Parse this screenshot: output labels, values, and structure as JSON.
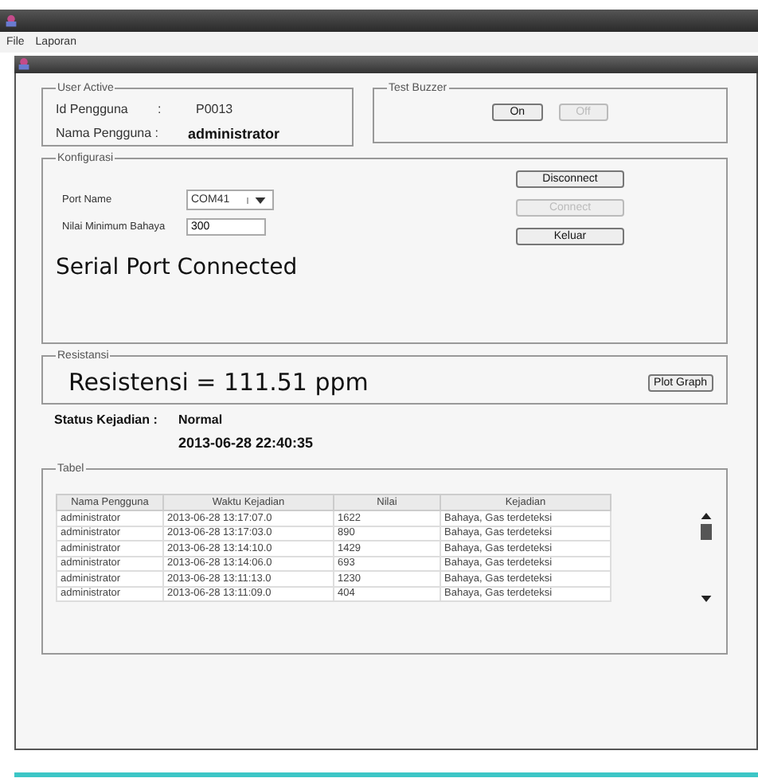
{
  "menu": [
    "File",
    "Laporan"
  ],
  "user_active": {
    "title": "User Active",
    "id_label": "Id Pengguna",
    "id_sep": ":",
    "id_value": "P0013",
    "name_label": "Nama Pengguna :",
    "name_value": "administrator"
  },
  "test_buzzer": {
    "title": "Test Buzzer",
    "buttons": [
      {
        "label": "On",
        "disabled": false
      },
      {
        "label": "Off",
        "disabled": true
      }
    ]
  },
  "konfigurasi": {
    "title": "Konfigurasi",
    "port_label": "Port Name",
    "port_value": "COM41",
    "min_label": "Nilai Minimum Bahaya",
    "min_value": "300",
    "status": "Serial Port Connected",
    "buttons": [
      {
        "label": "Disconnect",
        "disabled": false
      },
      {
        "label": "Connect",
        "disabled": true
      },
      {
        "label": "Keluar",
        "disabled": false
      }
    ]
  },
  "resistansi": {
    "title": "Resistansi",
    "reading": "Resistensi = 111.51 ppm",
    "button": "Plot Graph"
  },
  "status": {
    "label": "Status Kejadian :",
    "value": "Normal",
    "time": "2013-06-28 22:40:35"
  },
  "tabel": {
    "title": "Tabel",
    "columns": [
      "Nama Pengguna",
      "Waktu Kejadian",
      "Nilai",
      "Kejadian"
    ],
    "rows": [
      [
        "administrator",
        "2013-06-28 13:17:07.0",
        "1622",
        "Bahaya, Gas terdeteksi"
      ],
      [
        "administrator",
        "2013-06-28 13:17:03.0",
        "890",
        "Bahaya, Gas terdeteksi"
      ],
      [
        "administrator",
        "2013-06-28 13:14:10.0",
        "1429",
        "Bahaya, Gas terdeteksi"
      ],
      [
        "administrator",
        "2013-06-28 13:14:06.0",
        "693",
        "Bahaya, Gas terdeteksi"
      ],
      [
        "administrator",
        "2013-06-28 13:11:13.0",
        "1230",
        "Bahaya, Gas terdeteksi"
      ],
      [
        "administrator",
        "2013-06-28 13:11:09.0",
        "404",
        "Bahaya, Gas terdeteksi"
      ]
    ]
  }
}
